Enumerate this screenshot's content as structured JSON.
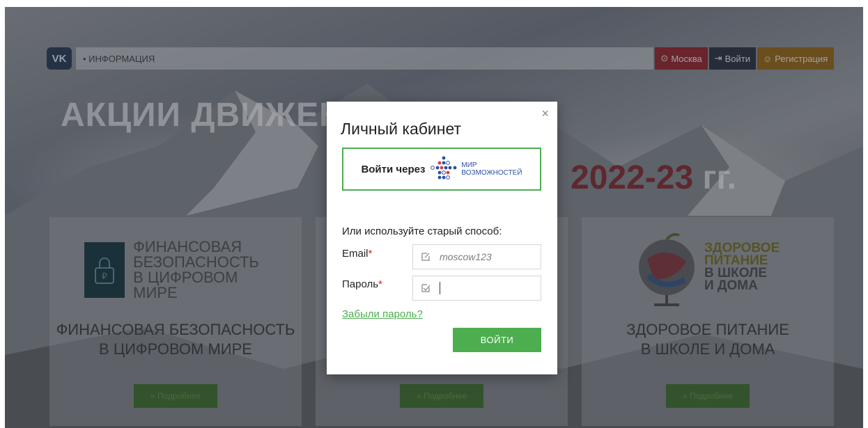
{
  "header": {
    "vk_logo": "VK",
    "menu_item": "• ИНФОРМАЦИЯ",
    "city": "Москва",
    "login": "Войти",
    "register": "Регистрация"
  },
  "hero": {
    "title": "АКЦИИ ДВИЖЕНИЯ",
    "years": "2022-23",
    "years_suffix": "гг."
  },
  "cards": [
    {
      "logo_lines": [
        "ФИНАНСОВАЯ",
        "БЕЗОПАСНОСТЬ",
        "В ЦИФРОВОМ МИРЕ"
      ],
      "title_lines": [
        "ФИНАНСОВАЯ БЕЗОПАСНОСТЬ",
        "В ЦИФРОВОМ МИРЕ"
      ],
      "button": "» Подробнее"
    },
    {
      "button": "» Подробнее"
    },
    {
      "logo_lines": [
        "ЗДОРОВОЕ",
        "ПИТАНИЕ",
        "В ШКОЛЕ",
        "И ДОМА"
      ],
      "title_lines": [
        "ЗДОРОВОЕ ПИТАНИЕ",
        "В ШКОЛЕ И ДОМА"
      ],
      "button": "» Подробнее"
    }
  ],
  "modal": {
    "title": "Личный кабинет",
    "close": "×",
    "sso_label": "Войти через",
    "sso_brand_line1": "МИР",
    "sso_brand_line2": "ВОЗМОЖНОСТЕЙ",
    "alt_text": "Или используйте старый способ:",
    "email_label": "Email",
    "password_label": "Пароль",
    "required_mark": "*",
    "email_value": "moscow123",
    "password_value": "",
    "forgot": "Забыли пароль?",
    "submit": "ВОЙТИ"
  },
  "colors": {
    "accent_green": "#4cae4f",
    "required_red": "#dd2222",
    "sso_brand_blue": "#2a4fa0"
  }
}
